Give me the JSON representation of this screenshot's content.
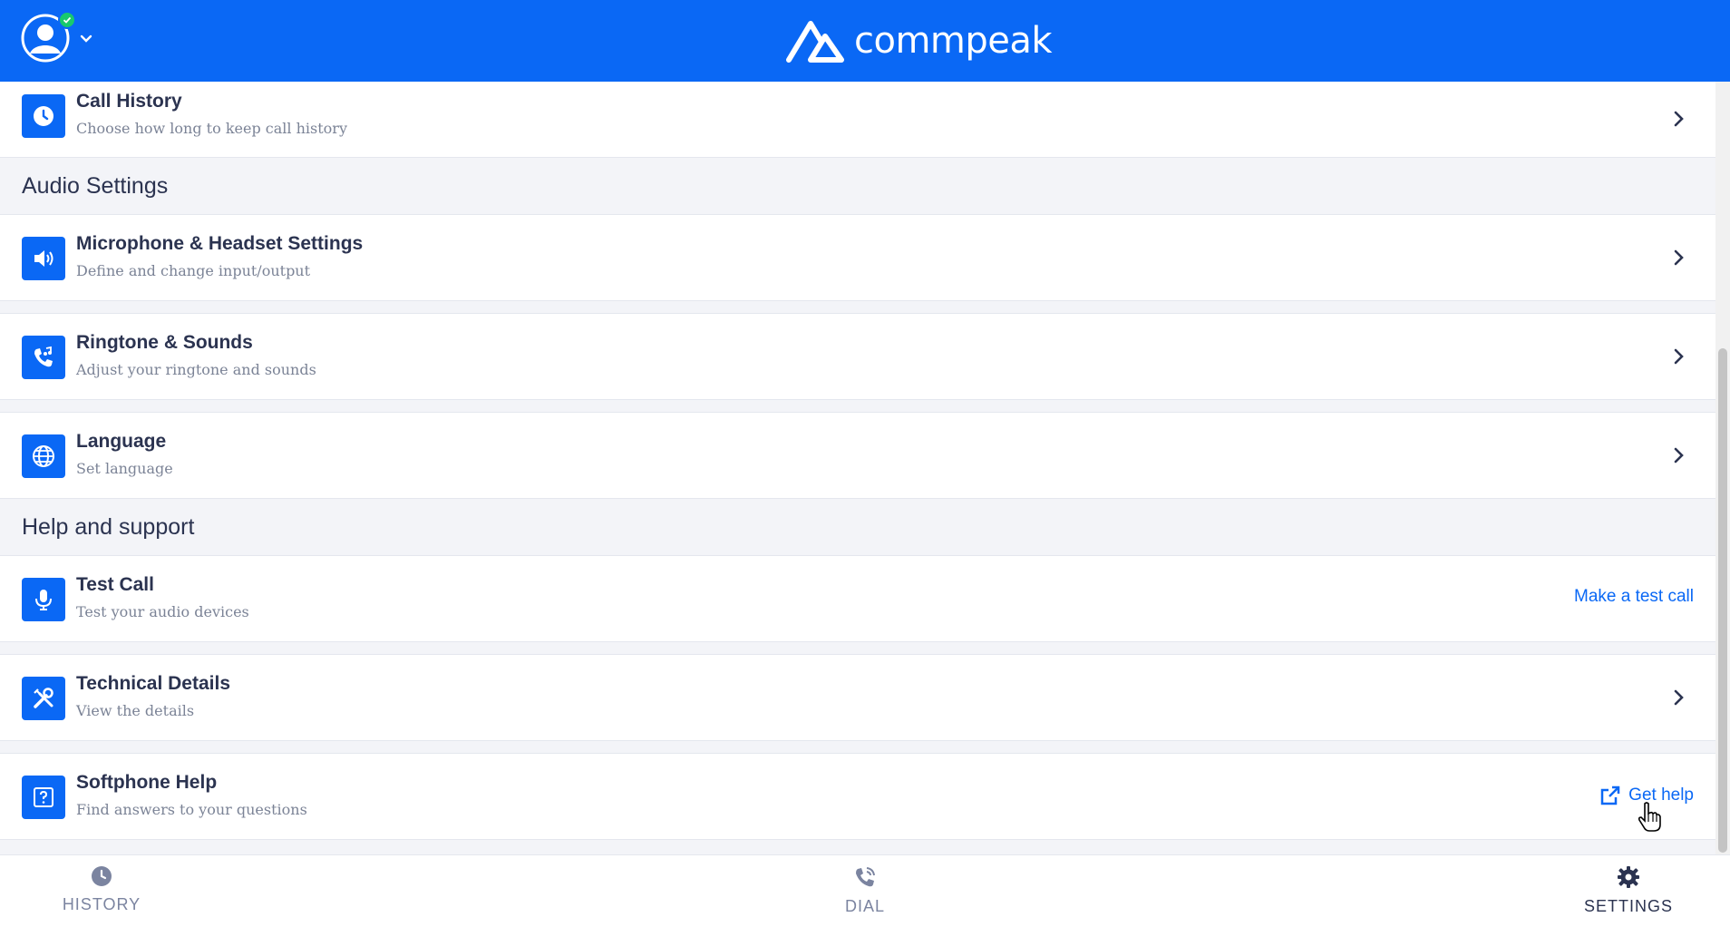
{
  "header": {
    "brand_name": "commpeak",
    "brand_color": "#0a68f5",
    "status_color": "#19c96d"
  },
  "settings": {
    "call_history": {
      "title": "Call History",
      "subtitle": "Choose how long to keep call history",
      "icon": "clock-icon"
    },
    "audio_section": "Audio Settings",
    "microphone": {
      "title": "Microphone & Headset Settings",
      "subtitle": "Define and change input/output",
      "icon": "speaker-icon"
    },
    "ringtone": {
      "title": "Ringtone & Sounds",
      "subtitle": "Adjust your ringtone and sounds",
      "icon": "phone-music-icon"
    },
    "language": {
      "title": "Language",
      "subtitle": "Set language",
      "icon": "globe-icon"
    },
    "help_section": "Help and support",
    "test_call": {
      "title": "Test Call",
      "subtitle": "Test your audio devices",
      "action": "Make a test call",
      "icon": "microphone-icon"
    },
    "technical": {
      "title": "Technical Details",
      "subtitle": "View the details",
      "icon": "tools-icon"
    },
    "softphone_help": {
      "title": "Softphone Help",
      "subtitle": "Find answers to your questions",
      "action": "Get help",
      "icon": "question-icon"
    }
  },
  "bottom_nav": {
    "history": "HISTORY",
    "dial": "DIAL",
    "settings": "SETTINGS",
    "active": "settings"
  }
}
